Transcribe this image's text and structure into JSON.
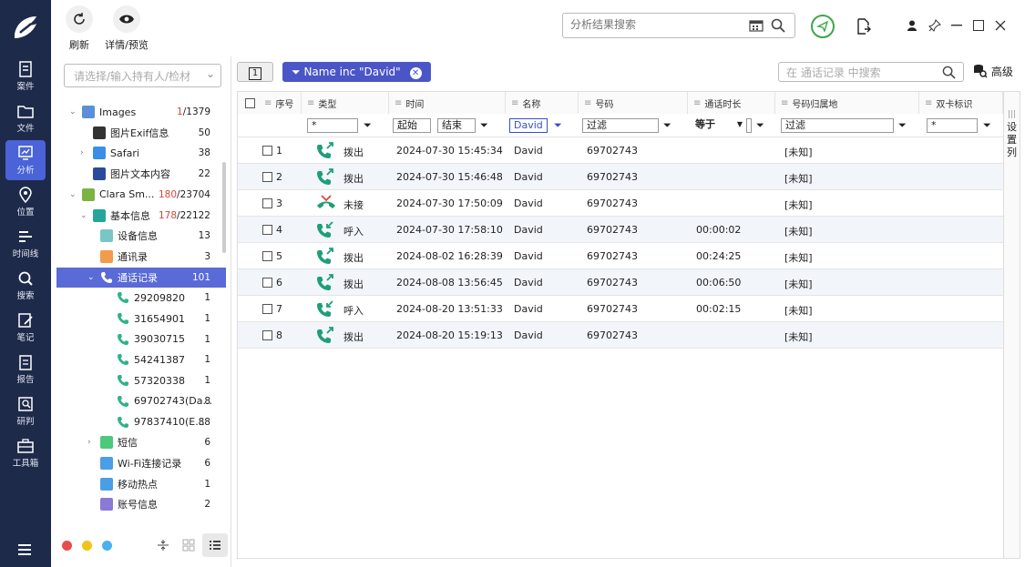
{
  "sidebar": {
    "items": [
      {
        "label": "案件",
        "icon": "case-icon"
      },
      {
        "label": "文件",
        "icon": "folder-icon"
      },
      {
        "label": "分析",
        "icon": "analysis-icon",
        "active": true
      },
      {
        "label": "位置",
        "icon": "location-icon"
      },
      {
        "label": "时间线",
        "icon": "timeline-icon"
      },
      {
        "label": "搜索",
        "icon": "search-icon"
      },
      {
        "label": "笔记",
        "icon": "note-icon"
      },
      {
        "label": "报告",
        "icon": "report-icon"
      },
      {
        "label": "研判",
        "icon": "judge-icon"
      },
      {
        "label": "工具箱",
        "icon": "toolbox-icon"
      }
    ]
  },
  "toolbar": {
    "refresh_label": "刷新",
    "preview_label": "详情/预览",
    "search_placeholder": "分析结果搜索"
  },
  "left_panel": {
    "person_placeholder": "请选择/输入持有人/检材",
    "tree": [
      {
        "label": "Images",
        "count": "1/1379",
        "count_hl": "1",
        "count_rest": "/1379",
        "level": 1,
        "tri": "v",
        "icon": "images-icon",
        "color": "#5b8fd8"
      },
      {
        "label": "图片Exif信息",
        "count": "50",
        "level": 2,
        "tri": "",
        "icon": "image-exif-icon",
        "color": "#333"
      },
      {
        "label": "Safari",
        "count": "38",
        "level": 2,
        "tri": ">",
        "icon": "safari-icon",
        "color": "#3a8ee6"
      },
      {
        "label": "图片文本内容",
        "count": "22",
        "level": 2,
        "tri": "",
        "icon": "ocr-icon",
        "color": "#2a4a9a"
      },
      {
        "label": "Clara Sm...",
        "count": "180/23704",
        "count_hl": "180",
        "count_rest": "/23704",
        "level": 1,
        "tri": "v",
        "icon": "android-icon",
        "color": "#7cb342"
      },
      {
        "label": "基本信息",
        "count": "178/22122",
        "count_hl": "178",
        "count_rest": "/22122",
        "level": 2,
        "tri": "v",
        "icon": "basic-info-icon",
        "color": "#26a69a"
      },
      {
        "label": "设备信息",
        "count": "13",
        "level": 3,
        "tri": "",
        "icon": "device-info-icon",
        "color": "#7ac6c6"
      },
      {
        "label": "通讯录",
        "count": "3",
        "level": 3,
        "tri": "",
        "icon": "contacts-icon",
        "color": "#f29b4a"
      },
      {
        "label": "通话记录",
        "count": "101",
        "level": 3,
        "tri": "v",
        "icon": "phone-icon",
        "color": "#2fb38a",
        "selected": true
      },
      {
        "label": "29209820",
        "count": "1",
        "level": 4,
        "tri": "",
        "icon": "phone-icon",
        "color": "#2fb38a"
      },
      {
        "label": "31654901",
        "count": "1",
        "level": 4,
        "tri": "",
        "icon": "phone-icon",
        "color": "#2fb38a"
      },
      {
        "label": "39030715",
        "count": "1",
        "level": 4,
        "tri": "",
        "icon": "phone-icon",
        "color": "#2fb38a"
      },
      {
        "label": "54241387",
        "count": "1",
        "level": 4,
        "tri": "",
        "icon": "phone-icon",
        "color": "#2fb38a"
      },
      {
        "label": "57320338",
        "count": "1",
        "level": 4,
        "tri": "",
        "icon": "phone-icon",
        "color": "#2fb38a"
      },
      {
        "label": "69702743(Da...",
        "count": "8",
        "level": 4,
        "tri": "",
        "icon": "phone-icon",
        "color": "#2fb38a"
      },
      {
        "label": "97837410(E...",
        "count": "88",
        "level": 4,
        "tri": "",
        "icon": "phone-icon",
        "color": "#2fb38a"
      },
      {
        "label": "短信",
        "count": "6",
        "level": 3,
        "tri": ">",
        "icon": "sms-icon",
        "color": "#4cc97a"
      },
      {
        "label": "Wi-Fi连接记录",
        "count": "6",
        "level": 3,
        "tri": "",
        "icon": "wifi-icon",
        "color": "#4a9ee6"
      },
      {
        "label": "移动热点",
        "count": "1",
        "level": 3,
        "tri": "",
        "icon": "hotspot-icon",
        "color": "#4a9ee6"
      },
      {
        "label": "账号信息",
        "count": "2",
        "level": 3,
        "tri": "",
        "icon": "account-icon",
        "color": "#8a7ad6"
      }
    ]
  },
  "filterbar": {
    "page": "1",
    "chip": "Name inc \"David\"",
    "search_placeholder": "在 通话记录 中搜索",
    "advanced": "高级"
  },
  "table": {
    "columns": [
      "序号",
      "类型",
      "时间",
      "名称",
      "号码",
      "通话时长",
      "号码归属地",
      "双卡标识"
    ],
    "filters": {
      "seq": "*",
      "start": "起始",
      "end": "结束",
      "name": "David",
      "number": "过滤",
      "duration_op": "等于",
      "location": "过滤",
      "sim": "*"
    },
    "rows": [
      {
        "no": "1",
        "type": "拨出",
        "icon": "outgoing-call-icon",
        "time": "2024-07-30 15:45:34",
        "name": "David",
        "number": "69702743",
        "duration": "",
        "location": "[未知]"
      },
      {
        "no": "2",
        "type": "拨出",
        "icon": "outgoing-call-icon",
        "time": "2024-07-30 15:46:48",
        "name": "David",
        "number": "69702743",
        "duration": "",
        "location": "[未知]"
      },
      {
        "no": "3",
        "type": "未接",
        "icon": "missed-call-icon",
        "time": "2024-07-30 17:50:09",
        "name": "David",
        "number": "69702743",
        "duration": "",
        "location": "[未知]"
      },
      {
        "no": "4",
        "type": "呼入",
        "icon": "incoming-call-icon",
        "time": "2024-07-30 17:58:10",
        "name": "David",
        "number": "69702743",
        "duration": "00:00:02",
        "location": "[未知]"
      },
      {
        "no": "5",
        "type": "拨出",
        "icon": "outgoing-call-icon",
        "time": "2024-08-02 16:28:39",
        "name": "David",
        "number": "69702743",
        "duration": "00:24:25",
        "location": "[未知]"
      },
      {
        "no": "6",
        "type": "拨出",
        "icon": "outgoing-call-icon",
        "time": "2024-08-08 13:56:45",
        "name": "David",
        "number": "69702743",
        "duration": "00:06:50",
        "location": "[未知]"
      },
      {
        "no": "7",
        "type": "呼入",
        "icon": "incoming-call-icon",
        "time": "2024-08-20 13:51:33",
        "name": "David",
        "number": "69702743",
        "duration": "00:02:15",
        "location": "[未知]"
      },
      {
        "no": "8",
        "type": "拨出",
        "icon": "outgoing-call-icon",
        "time": "2024-08-20 15:19:13",
        "name": "David",
        "number": "69702743",
        "duration": "",
        "location": "[未知]"
      }
    ],
    "side_label": "设置列"
  },
  "colors": {
    "sidebar_bg": "#1e2a4a",
    "accent": "#4a56c6",
    "selected": "#5a6ad6",
    "call_green": "#1f9e78",
    "missed_red": "#d9463a",
    "count_red": "#d9463a"
  }
}
